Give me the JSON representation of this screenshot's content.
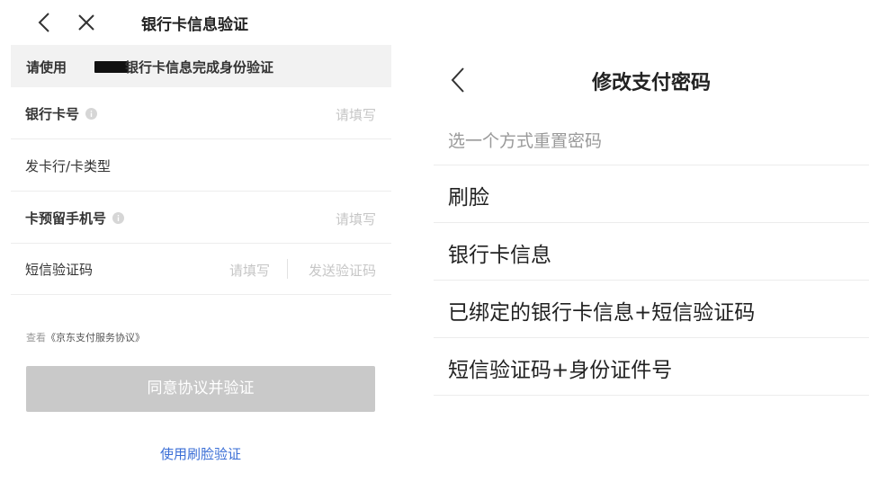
{
  "left": {
    "header": {
      "title": "银行卡信息验证"
    },
    "notice": {
      "prefix": "请使用",
      "suffix": "银行卡信息完成身份验证"
    },
    "form": [
      {
        "label": "银行卡号",
        "placeholder": "请填写"
      },
      {
        "label": "发卡行/卡类型"
      },
      {
        "label": "卡预留手机号",
        "placeholder": "请填写"
      },
      {
        "label": "短信验证码",
        "placeholder": "请填写",
        "action": "发送验证码"
      }
    ],
    "agreement": {
      "prefix": "查看",
      "link": "《京东支付服务协议》"
    },
    "submit_label": "同意协议并验证",
    "face_link": "使用刷脸验证"
  },
  "right": {
    "title": "修改支付密码",
    "section_label": "选一个方式重置密码",
    "options": [
      {
        "label": "刷脸"
      },
      {
        "label": "银行卡信息"
      },
      {
        "label": "已绑定的银行卡信息+短信验证码"
      },
      {
        "label": "短信验证码+身份证件号"
      }
    ]
  },
  "colors": {
    "primary_text": "#222222",
    "placeholder": "#c6c6c6",
    "notice_bg": "#f2f2f2",
    "button_disabled": "#c9c9c9",
    "link": "#3a6ed6",
    "divider": "#ececec"
  },
  "icons": {
    "back": "chevron-left-icon",
    "close": "close-icon",
    "info": "info-circle-icon"
  }
}
